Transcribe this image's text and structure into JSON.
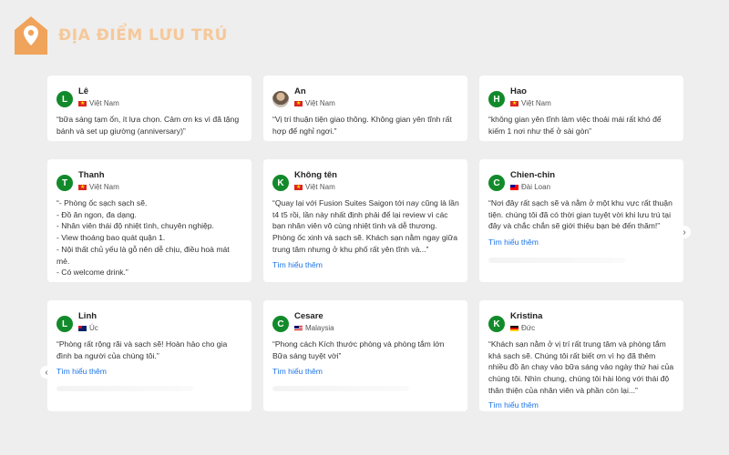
{
  "brand": {
    "title": "ĐỊA ĐIỂM LƯU TRÚ",
    "accent": "#f0a35a"
  },
  "reviews": [
    {
      "name": "Lê",
      "avatar": "L",
      "country": "Việt Nam",
      "text": "“bữa sáng tạm ổn, ít lựa chọn. Cảm ơn ks vì đã tặng bánh và set up giường (anniversary)”"
    },
    {
      "name": "An",
      "avatar": "",
      "country": "Việt Nam",
      "text": "“Vị trí thuận tiện giao thông. Không gian yên tĩnh rất hợp để nghỉ ngơi.”"
    },
    {
      "name": "Hao",
      "avatar": "H",
      "country": "Việt Nam",
      "text": "“không gian yên tĩnh làm việc thoải mái rất khó để kiếm 1 nơi như thế ở sài gòn”"
    },
    {
      "name": "Thanh",
      "avatar": "T",
      "country": "Việt Nam",
      "text": "“- Phòng ốc sạch sạch sẽ.\n- Đồ ăn ngon, đa dạng.\n- Nhân viên thái độ nhiệt tình, chuyên nghiệp.\n- View thoáng bao quát quận 1.\n- Nội thất chủ yếu là gỗ nên dễ chịu, điều hoà mát mẻ.\n- Có welcome drink.”"
    },
    {
      "name": "Không tên",
      "avatar": "K",
      "country": "Việt Nam",
      "text": "“Quay lại với Fusion Suites Saigon tới nay cũng là lần t4 t5 rồi, lần này nhất định phải để lại review vì các bạn nhân viên vô cùng nhiệt tình và dễ thương. Phòng ốc xinh và sạch sẽ. Khách sạn nằm ngay giữa trung tâm nhưng ở khu phố rất yên tĩnh và...”",
      "more": "Tìm hiểu thêm"
    },
    {
      "name": "Chien-chin",
      "avatar": "C",
      "country": "Đài Loan",
      "text": "“Nơi đây rất sạch sẽ và nằm ở một khu vực rất thuận tiện. chúng tôi đã có thời gian tuyệt vời khi lưu trú tại đây và chắc chắn sẽ giới thiệu bạn bè đến thăm!”",
      "more": "Tìm hiểu thêm"
    },
    {
      "name": "Linh",
      "avatar": "L",
      "country": "Úc",
      "text": "“Phòng rất rộng rãi và sạch sẽ! Hoàn hảo cho gia đình ba người của chúng tôi.”",
      "more": "Tìm hiểu thêm"
    },
    {
      "name": "Cesare",
      "avatar": "C",
      "country": "Malaysia",
      "text": "“Phong cách Kích thước phòng và phòng tắm lớn Bữa sáng tuyệt vời”",
      "more": "Tìm hiểu thêm"
    },
    {
      "name": "Kristina",
      "avatar": "K",
      "country": "Đức",
      "text": "“Khách sạn nằm ở vị trí rất trung tâm và phòng tắm khá sạch sẽ. Chúng tôi rất biết ơn vì họ đã thêm nhiều đồ ăn chay vào bữa sáng vào ngày thứ hai của chúng tôi. Nhìn chung, chúng tôi hài lòng với thái độ thân thiện của nhân viên và phần còn lại...”",
      "more": "Tìm hiểu thêm"
    }
  ],
  "nav": {
    "prev": "‹",
    "next": "›"
  }
}
